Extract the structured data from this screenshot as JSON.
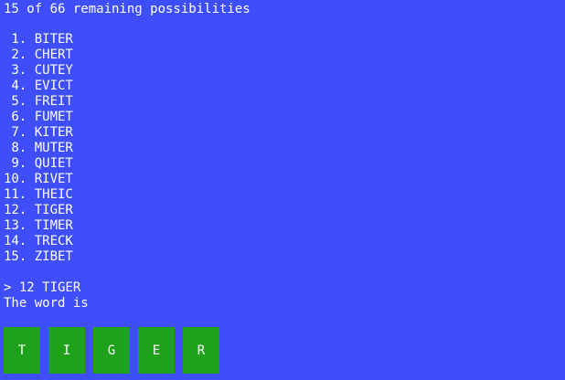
{
  "header": "15 of 66 remaining possibilities",
  "possibilities": [
    " 1. BITER",
    " 2. CHERT",
    " 3. CUTEY",
    " 4. EVICT",
    " 5. FREIT",
    " 6. FUMET",
    " 7. KITER",
    " 8. MUTER",
    " 9. QUIET",
    "10. RIVET",
    "11. THEIC",
    "12. TIGER",
    "13. TIMER",
    "14. TRECK",
    "15. ZIBET"
  ],
  "command": "> 12 TIGER",
  "result": "The word is",
  "tiles": [
    "T",
    "I",
    "G",
    "E",
    "R"
  ],
  "colors": {
    "background": "#3d4efa",
    "tile": "#1fa11b",
    "text": "#ffffff"
  }
}
